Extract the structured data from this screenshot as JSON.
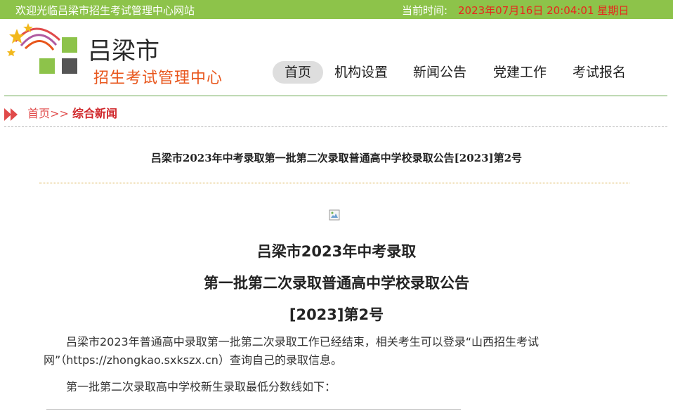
{
  "topbar": {
    "welcome": "欢迎光临吕梁市招生考试管理中心网站",
    "time_label": "当前时间:",
    "time_value": "2023年07月16日 20:04:01 星期日"
  },
  "header": {
    "site_name": "吕梁市",
    "site_sub": "招生考试管理中心",
    "nav": [
      "首页",
      "机构设置",
      "新闻公告",
      "党建工作",
      "考试报名"
    ],
    "active_nav": "首页"
  },
  "breadcrumb": {
    "home": "首页",
    "separator": ">>",
    "current": "综合新闻"
  },
  "article": {
    "title": "吕梁市2023年中考录取第一批第二次录取普通高中学校录取公告[2023]第2号",
    "heading_1": "吕梁市2023年中考录取",
    "heading_2": "第一批第二次录取普通高中学校录取公告",
    "heading_3": "[2023]第2号",
    "paragraph_1": "吕梁市2023年普通高中录取第一批第二次录取工作已经结束，相关考生可以登录“山西招生考试网”（https://zhongkao.sxkszx.cn）查询自己的录取信息。",
    "paragraph_2": "第一批第二次录取高中学校新生录取最低分数线如下："
  },
  "colors": {
    "topbar": "#8dc34a",
    "accent_red": "#e8261c",
    "subtitle_orange": "#e8561c",
    "divider_green": "#6aa84f"
  }
}
